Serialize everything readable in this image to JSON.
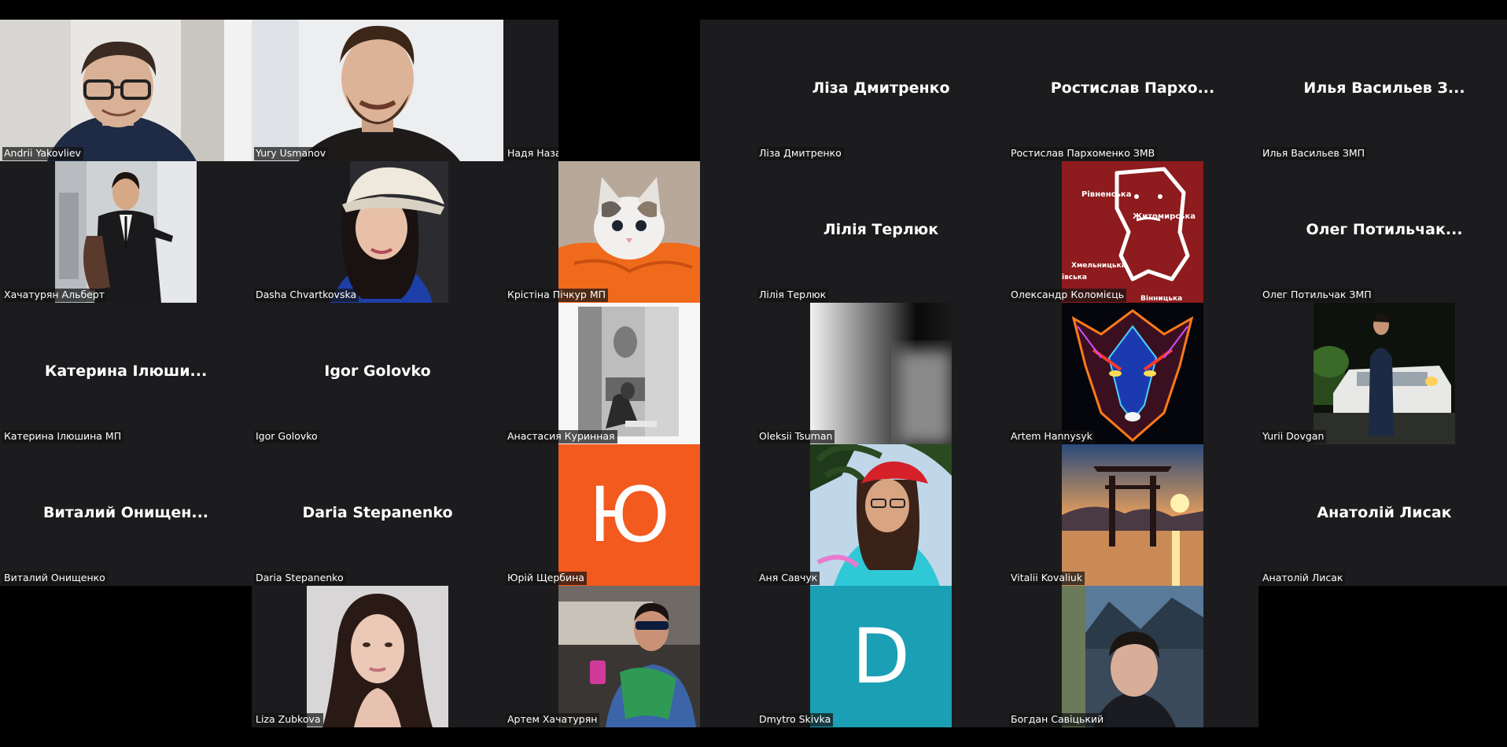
{
  "app": {
    "name": "Video conference gallery view"
  },
  "colors": {
    "panel_bg": "#1c1c1e",
    "page_bg": "#000000",
    "avatar_orange": "#f25a1e",
    "avatar_teal": "#1a9fb5",
    "map_red": "#8e1b1d"
  },
  "left_grid": {
    "participants": [
      {
        "name": "Andrii Yakovliev",
        "center_name": "",
        "video": "man-glasses"
      },
      {
        "name": "Yury Usmanov",
        "center_name": "",
        "video": "man-beard"
      },
      {
        "name": "Надя Назаренко",
        "center_name": "",
        "video": "none"
      },
      {
        "name": "Хачатурян Альберт",
        "center_name": "",
        "video": "man-suit"
      },
      {
        "name": "Dasha Chvartkovska",
        "center_name": "",
        "video": "girl-cap"
      },
      {
        "name": "Крістіна Пічкур МП",
        "center_name": "",
        "video": "kitten"
      },
      {
        "name": "Катерина Ілюшина МП",
        "center_name": "Катерина Ілюши...",
        "video": "none"
      },
      {
        "name": "Igor Golovko",
        "center_name": "Igor Golovko",
        "video": "none"
      },
      {
        "name": "Анастасия Куринная",
        "center_name": "",
        "video": "bw-photo"
      },
      {
        "name": "Виталий Онищенко",
        "center_name": "Виталий  Онищен...",
        "video": "none"
      },
      {
        "name": "Daria Stepanenko",
        "center_name": "Daria Stepanenko",
        "video": "none"
      },
      {
        "name": "Юрій Щербина",
        "center_name": "",
        "video": "avatar-letter",
        "letter": "Ю"
      },
      {
        "name": "Liza Zubkova",
        "center_name": "",
        "video": "girl-portrait"
      },
      {
        "name": "Артем Хачатурян",
        "center_name": "",
        "video": "man-car"
      }
    ]
  },
  "right_grid": {
    "participants": [
      {
        "name": "Ліза Дмитренко",
        "center_name": "Ліза Дмитренко",
        "video": "none"
      },
      {
        "name": "Ростислав Пархоменко ЗМВ",
        "center_name": "Ростислав  Пархо...",
        "video": "none"
      },
      {
        "name": "Илья Васильев ЗМП",
        "center_name": "Илья  Васильев  З...",
        "video": "none"
      },
      {
        "name": "Лілія Терлюк",
        "center_name": "Лілія Терлюк",
        "video": "none"
      },
      {
        "name": "Олександр Коломієць",
        "center_name": "",
        "video": "map",
        "map_labels": [
          "Рівненська",
          "Житомирська",
          "Хмельницька",
          "Вінницька",
          "ївська"
        ]
      },
      {
        "name": "Олег Потильчак ЗМП",
        "center_name": "Олег  Потильчак...",
        "video": "none"
      },
      {
        "name": "Oleksii Tsuman",
        "center_name": "",
        "video": "blur"
      },
      {
        "name": "Artem Hannysyk",
        "center_name": "",
        "video": "wolf"
      },
      {
        "name": "Yurii Dovgan",
        "center_name": "",
        "video": "man-car-night"
      },
      {
        "name": "Аня Савчук",
        "center_name": "",
        "video": "girl-palm"
      },
      {
        "name": "Vitalii Kovaliuk",
        "center_name": "",
        "video": "torii"
      },
      {
        "name": "Анатолій Лисак",
        "center_name": "Анатолій Лисак",
        "video": "none"
      },
      {
        "name": "Dmytro Skivka",
        "center_name": "",
        "video": "avatar-letter",
        "letter": "D"
      },
      {
        "name": "Богдан Савіцький",
        "center_name": "",
        "video": "boy"
      }
    ]
  }
}
